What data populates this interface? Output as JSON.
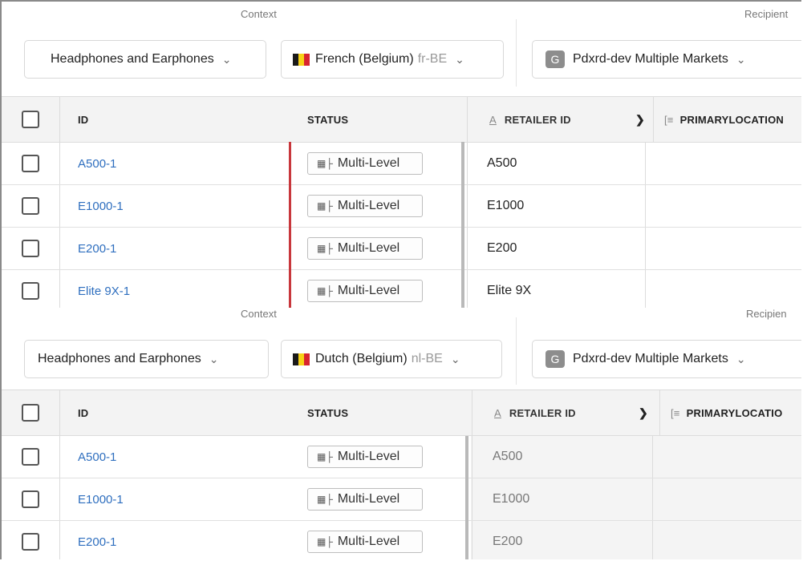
{
  "panels": [
    {
      "context_label": "Context",
      "recipient_label": "Recipient",
      "category": "Headphones and Earphones",
      "locale": {
        "name": "French (Belgium)",
        "code": "fr-BE"
      },
      "recipient_badge": "G",
      "recipient": "Pdxrd-dev Multiple Markets",
      "columns": {
        "id": "ID",
        "status": "STATUS",
        "retailer_id": "RETAILER ID",
        "primary_location": "PRIMARYLOCATION"
      },
      "rows": [
        {
          "id": "A500-1",
          "status": "Multi-Level",
          "retailer_id": "A500"
        },
        {
          "id": "E1000-1",
          "status": "Multi-Level",
          "retailer_id": "E1000"
        },
        {
          "id": "E200-1",
          "status": "Multi-Level",
          "retailer_id": "E200"
        },
        {
          "id": "Elite 9X-1",
          "status": "Multi-Level",
          "retailer_id": "Elite 9X"
        }
      ]
    },
    {
      "context_label": "Context",
      "recipient_label": "Recipien",
      "category": "Headphones and Earphones",
      "locale": {
        "name": "Dutch (Belgium)",
        "code": "nl-BE"
      },
      "recipient_badge": "G",
      "recipient": "Pdxrd-dev Multiple Markets",
      "columns": {
        "id": "ID",
        "status": "STATUS",
        "retailer_id": "RETAILER ID",
        "primary_location": "PRIMARYLOCATIO"
      },
      "rows": [
        {
          "id": "A500-1",
          "status": "Multi-Level",
          "retailer_id": "A500"
        },
        {
          "id": "E1000-1",
          "status": "Multi-Level",
          "retailer_id": "E1000"
        },
        {
          "id": "E200-1",
          "status": "Multi-Level",
          "retailer_id": "E200"
        }
      ]
    }
  ],
  "icons": {
    "chevron": "chevron-down-icon",
    "flag": "belgium-flag-icon",
    "status": "multi-level-tree-icon",
    "retailer": "text-attribute-icon",
    "primary": "list-attribute-icon"
  },
  "colors": {
    "link": "#2f6fbf",
    "status_marker": "#c8373c",
    "flag": [
      "#1a1a1a",
      "#f7d117",
      "#d8242f"
    ]
  }
}
